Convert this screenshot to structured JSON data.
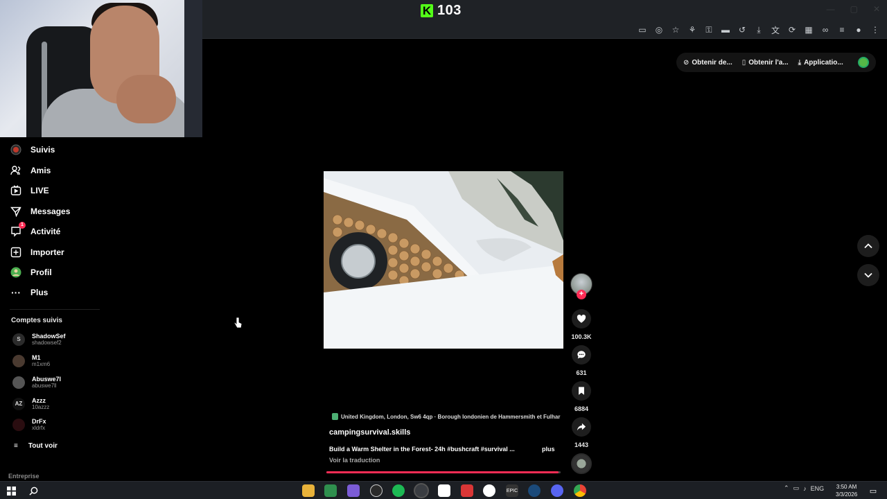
{
  "kick": {
    "count": "103"
  },
  "top_bar": {
    "items": [
      {
        "label": "Obtenir de...",
        "icon": "circle-slash-icon"
      },
      {
        "label": "Obtenir l'a...",
        "icon": "phone-icon"
      },
      {
        "label": "Applicatio...",
        "icon": "download-icon"
      }
    ]
  },
  "sidebar": {
    "nav": [
      {
        "label": "Suivis",
        "icon": "following-icon"
      },
      {
        "label": "Amis",
        "icon": "friends-icon"
      },
      {
        "label": "LIVE",
        "icon": "live-icon"
      },
      {
        "label": "Messages",
        "icon": "messages-icon"
      },
      {
        "label": "Activité",
        "icon": "activity-icon",
        "badge": "1"
      },
      {
        "label": "Importer",
        "icon": "upload-icon"
      },
      {
        "label": "Profil",
        "icon": "profile-icon"
      },
      {
        "label": "Plus",
        "icon": "more-icon"
      }
    ],
    "following_title": "Comptes suivis",
    "accounts": [
      {
        "name": "ShadowSef",
        "handle": "shadowsef2"
      },
      {
        "name": "M1",
        "handle": "m1xm6"
      },
      {
        "name": "Abuswe7l",
        "handle": "abuswe7ll"
      },
      {
        "name": "Azzz",
        "handle": "10azzz"
      },
      {
        "name": "DrFx",
        "handle": "xldrfx"
      }
    ],
    "see_all": "Tout voir",
    "footer": "Entreprise"
  },
  "video": {
    "location": "United Kingdom, London, Sw6 4qp · Borough londonien de Hammersmith et Fulhar",
    "username": "campingsurvival.skills",
    "description": "Build a Warm Shelter in the Forest- 24h #bushcraft #survival ...",
    "more": "plus",
    "translate": "Voir la traduction",
    "progress": 0.99
  },
  "actions": {
    "likes": "100.3K",
    "comments": "631",
    "saves": "6884",
    "shares": "1443"
  },
  "taskbar": {
    "language": "ENG",
    "time": "3:50 AM",
    "date": "3/3/2026"
  },
  "colors": {
    "accent": "#fe2c55",
    "kick_green": "#53fc18",
    "background": "#000000"
  }
}
